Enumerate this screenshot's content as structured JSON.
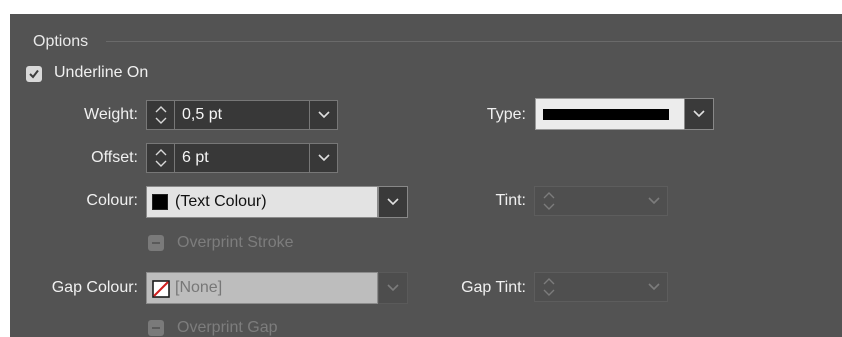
{
  "options": {
    "section_title": "Options",
    "underline_on": {
      "label": "Underline On",
      "checked": true
    },
    "weight": {
      "label": "Weight:",
      "value": "0,5 pt"
    },
    "offset": {
      "label": "Offset:",
      "value": "6 pt"
    },
    "type": {
      "label": "Type:",
      "value_icon": "solid-line"
    },
    "colour": {
      "label": "Colour:",
      "value": "(Text Colour)",
      "swatch": "#000000"
    },
    "tint": {
      "label": "Tint:",
      "value": ""
    },
    "overprint_stroke": {
      "label": "Overprint Stroke",
      "enabled": false
    },
    "gap_colour": {
      "label": "Gap Colour:",
      "value": "[None]",
      "swatch_icon": "none-swatch"
    },
    "gap_tint": {
      "label": "Gap Tint:",
      "value": ""
    },
    "overprint_gap": {
      "label": "Overprint Gap",
      "enabled": false
    }
  },
  "colors": {
    "panel": "#535353",
    "field": "#383838",
    "accent_none": "#d01f1f"
  }
}
